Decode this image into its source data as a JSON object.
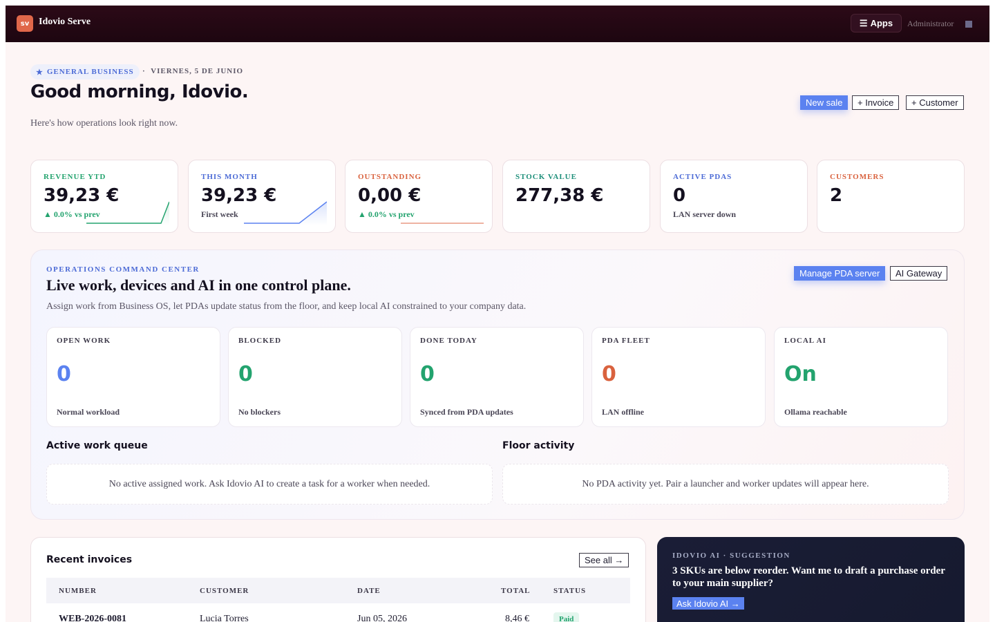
{
  "topbar": {
    "logo": "sv",
    "brand": "Idovio Serve",
    "apps_label": "Apps",
    "user": "Administrator"
  },
  "header": {
    "chip": "GENERAL BUSINESS",
    "date": "VIERNES, 5 DE JUNIO",
    "greeting": "Good morning, Idovio.",
    "subtitle": "Here's how operations look right now.",
    "buttons": {
      "new_sale": "New sale",
      "invoice": "+ Invoice",
      "customer": "+ Customer"
    }
  },
  "kpis": [
    {
      "label": "REVENUE YTD",
      "value": "39,23 €",
      "note": "▲ 0.0% vs prev",
      "color": "#23a36e"
    },
    {
      "label": "THIS MONTH",
      "value": "39,23 €",
      "note": "First week",
      "color": "#4c6bd6"
    },
    {
      "label": "OUTSTANDING",
      "value": "0,00 €",
      "note": "▲ 0.0% vs prev",
      "color": "#d9623e"
    },
    {
      "label": "STOCK VALUE",
      "value": "277,38 €",
      "note": "",
      "color": "#1e8f7a"
    },
    {
      "label": "ACTIVE PDAS",
      "value": "0",
      "note": "LAN server down",
      "color": "#4c6bd6"
    },
    {
      "label": "CUSTOMERS",
      "value": "2",
      "note": "",
      "color": "#d9623e"
    }
  ],
  "command_center": {
    "eyebrow": "OPERATIONS COMMAND CENTER",
    "title": "Live work, devices and AI in one control plane.",
    "subtitle": "Assign work from Business OS, let PDAs update status from the floor, and keep local AI constrained to your company data.",
    "buttons": {
      "manage": "Manage PDA server",
      "gateway": "AI Gateway"
    },
    "metrics": [
      {
        "label": "OPEN WORK",
        "value": "0",
        "note": "Normal workload",
        "color": "#5b82f0"
      },
      {
        "label": "BLOCKED",
        "value": "0",
        "note": "No blockers",
        "color": "#23a36e"
      },
      {
        "label": "DONE TODAY",
        "value": "0",
        "note": "Synced from PDA updates",
        "color": "#23a36e"
      },
      {
        "label": "PDA FLEET",
        "value": "0",
        "note": "LAN offline",
        "color": "#d9623e"
      },
      {
        "label": "LOCAL AI",
        "value": "On",
        "note": "Ollama reachable",
        "color": "#23a36e"
      }
    ],
    "queue": {
      "title": "Active work queue",
      "empty": "No active assigned work. Ask Idovio AI to create a task for a worker when needed."
    },
    "activity": {
      "title": "Floor activity",
      "empty": "No PDA activity yet. Pair a launcher and worker updates will appear here."
    }
  },
  "invoices": {
    "title": "Recent invoices",
    "see_all": "See all →",
    "columns": [
      "NUMBER",
      "CUSTOMER",
      "DATE",
      "TOTAL",
      "STATUS"
    ],
    "rows": [
      {
        "number": "WEB-2026-0081",
        "customer": "Lucia Torres",
        "date": "Jun 05, 2026",
        "total": "8,46 €",
        "status": "Paid"
      }
    ]
  },
  "ai_card": {
    "eyebrow": "IDOVIO AI · SUGGESTION",
    "text": "3 SKUs are below reorder. Want me to draft a purchase order to your main supplier?",
    "button": "Ask Idovio AI →"
  }
}
